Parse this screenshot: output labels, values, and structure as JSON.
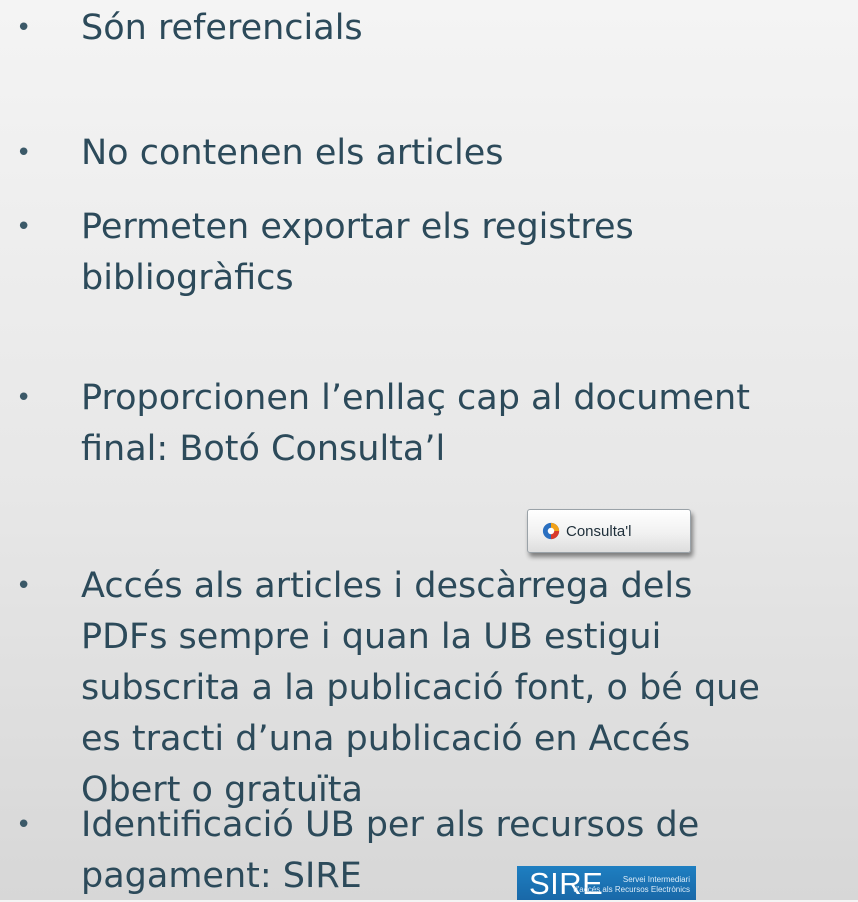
{
  "bullets": [
    {
      "symbol": "•",
      "lines": [
        "Són referencials"
      ]
    },
    {
      "symbol": "•",
      "lines": [
        "No contenen els articles"
      ]
    },
    {
      "symbol": "•",
      "lines": [
        "Permeten exportar els registres",
        "bibliogràfics"
      ]
    },
    {
      "symbol": "•",
      "lines": [
        "Proporcionen l’enllaç cap al document",
        "final: Botó Consulta’l"
      ]
    },
    {
      "symbol": "•",
      "lines": [
        "Accés als articles i descàrrega dels",
        "PDFs sempre i quan la UB estigui",
        "subscrita a la publicació font, o bé que",
        "es tracti d’una publicació en Accés",
        "Obert o gratuïta"
      ]
    },
    {
      "symbol": "•",
      "lines": [
        "Identificació UB per als recursos de",
        "pagament: SIRE"
      ]
    }
  ],
  "consulta_button": {
    "label": "Consulta'l",
    "icon": "circle-arrow-icon"
  },
  "sire_badge": {
    "title": "SIRE",
    "caption_line_1": "Servei Intermediari",
    "caption_line_2": "d'accés als Recursos Electrònics",
    "color": "#1e7fc1"
  },
  "colors": {
    "text": "#2c4a5a",
    "background_top": "#f4f4f4",
    "background_bottom": "#d7d7d7"
  }
}
